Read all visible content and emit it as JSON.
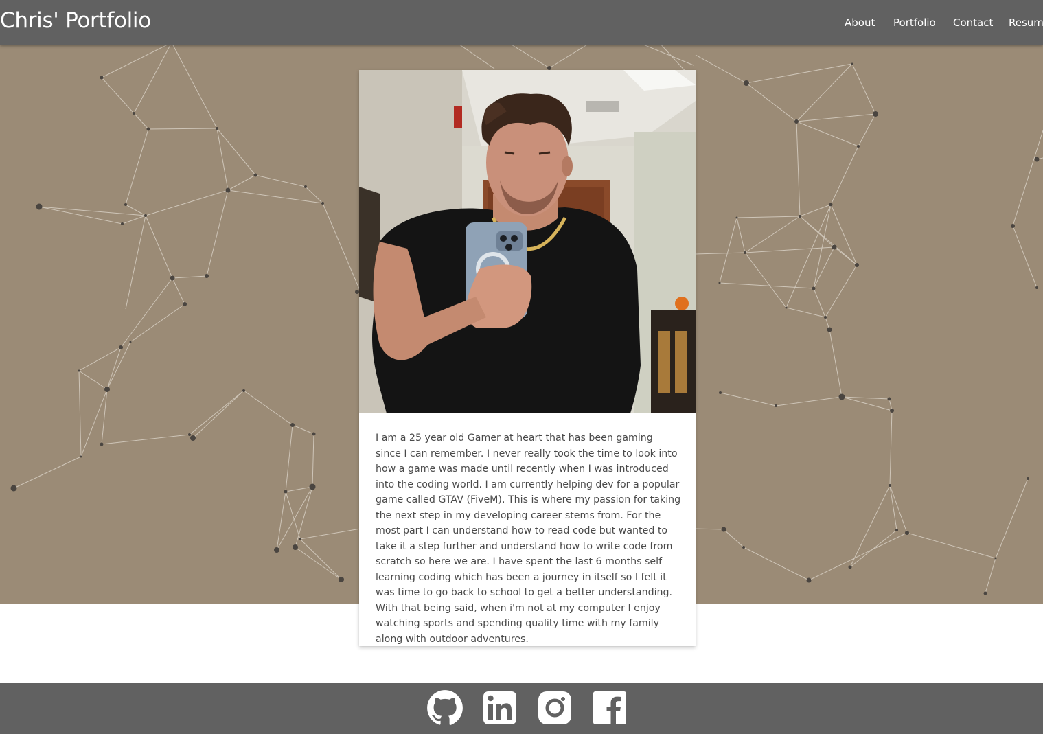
{
  "header": {
    "brand": "Chris' Portfolio",
    "nav": [
      "About",
      "Portfolio",
      "Contact",
      "Resume"
    ]
  },
  "about": {
    "bio": "I am a 25 year old Gamer at heart that has been gaming since I can remember. I never really took the time to look into how a game was made until recently when I was introduced into the coding world. I am currently helping dev for a popular game called GTAV (FiveM). This is where my passion for taking the next step in my developing career stems from. For the most part I can understand how to read code but wanted to take it a step further and understand how to write code from scratch so here we are. I have spent the last 6 months self learning coding which has been a journey in itself so I felt it was time to go back to school to get a better understanding. With that being said, when i'm not at my computer I enjoy watching sports and spending quality time with my family along with outdoor adventures.",
    "photo_icon": "profile-photo"
  },
  "footer": {
    "social_icons": [
      "github-icon",
      "linkedin-icon",
      "instagram-icon",
      "facebook-icon"
    ]
  },
  "colors": {
    "nav_bg": "#616161",
    "hero_bg": "#9b8b76",
    "node": "#4a4540",
    "line": "#d8d0c4",
    "text": "#4a4a4a"
  }
}
